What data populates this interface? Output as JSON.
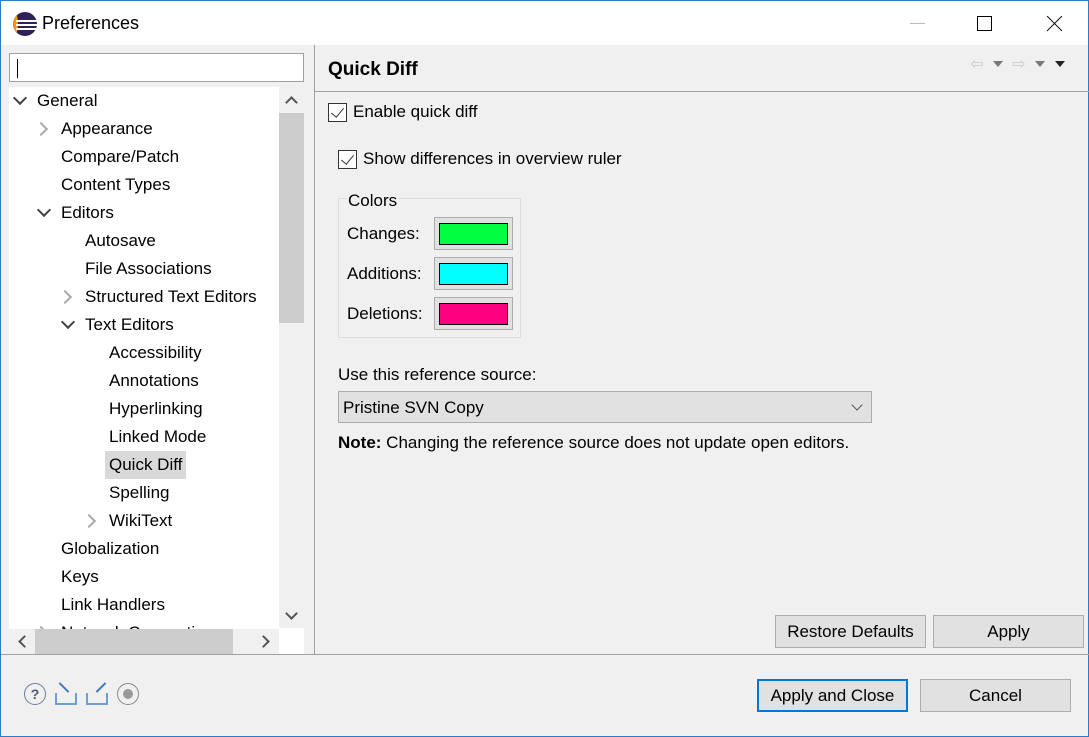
{
  "window": {
    "title": "Preferences",
    "controls": {
      "minimize": "minimize",
      "maximize": "maximize",
      "close": "close"
    }
  },
  "filter": {
    "value": "",
    "placeholder": ""
  },
  "tree": {
    "items": [
      {
        "label": "General",
        "level": 0,
        "expander": "open"
      },
      {
        "label": "Appearance",
        "level": 1,
        "expander": "closed"
      },
      {
        "label": "Compare/Patch",
        "level": 1,
        "expander": "none"
      },
      {
        "label": "Content Types",
        "level": 1,
        "expander": "none"
      },
      {
        "label": "Editors",
        "level": 1,
        "expander": "open"
      },
      {
        "label": "Autosave",
        "level": 2,
        "expander": "none"
      },
      {
        "label": "File Associations",
        "level": 2,
        "expander": "none"
      },
      {
        "label": "Structured Text Editors",
        "level": 2,
        "expander": "closed"
      },
      {
        "label": "Text Editors",
        "level": 2,
        "expander": "open"
      },
      {
        "label": "Accessibility",
        "level": 3,
        "expander": "none"
      },
      {
        "label": "Annotations",
        "level": 3,
        "expander": "none"
      },
      {
        "label": "Hyperlinking",
        "level": 3,
        "expander": "none"
      },
      {
        "label": "Linked Mode",
        "level": 3,
        "expander": "none"
      },
      {
        "label": "Quick Diff",
        "level": 3,
        "expander": "none",
        "selected": true
      },
      {
        "label": "Spelling",
        "level": 3,
        "expander": "none"
      },
      {
        "label": "WikiText",
        "level": 3,
        "expander": "closed"
      },
      {
        "label": "Globalization",
        "level": 1,
        "expander": "none"
      },
      {
        "label": "Keys",
        "level": 1,
        "expander": "none"
      },
      {
        "label": "Link Handlers",
        "level": 1,
        "expander": "none"
      },
      {
        "label": "Network Connections",
        "level": 1,
        "expander": "closed"
      }
    ]
  },
  "page": {
    "title": "Quick Diff",
    "nav": {
      "back": "⇦",
      "forward": "⇨"
    },
    "enable_quick_diff": {
      "label": "Enable quick diff",
      "checked": true
    },
    "show_overview": {
      "label": "Show differences in overview ruler",
      "checked": true
    },
    "colors": {
      "legend": "Colors",
      "items": [
        {
          "label": "Changes:",
          "color": "#00ff40"
        },
        {
          "label": "Additions:",
          "color": "#00ffff"
        },
        {
          "label": "Deletions:",
          "color": "#ff0080"
        }
      ]
    },
    "reference": {
      "label": "Use this reference source:",
      "selected": "Pristine SVN Copy"
    },
    "note": {
      "bold": "Note:",
      "text": " Changing the reference source does not update open editors."
    },
    "restore_defaults": "Restore Defaults",
    "apply": "Apply"
  },
  "footer": {
    "help": "?",
    "apply_and_close": "Apply and Close",
    "cancel": "Cancel"
  }
}
